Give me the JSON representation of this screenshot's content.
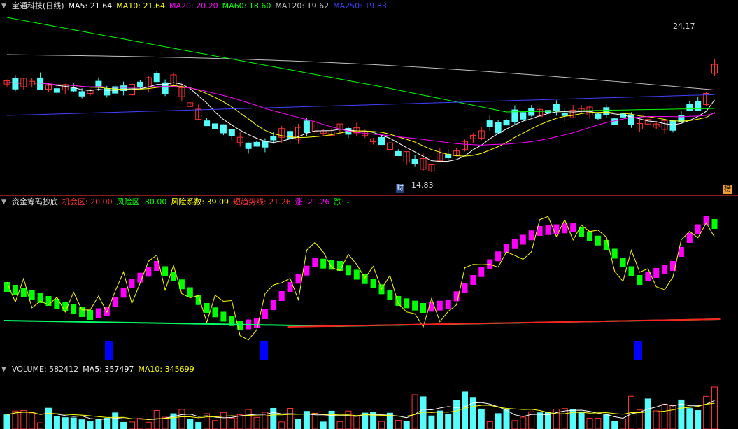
{
  "main": {
    "stock_name": "宝通科技(日线)",
    "ma5": "MA5: 21.64",
    "ma10": "MA10: 21.64",
    "ma20": "MA20: 20.20",
    "ma60": "MA60: 18.60",
    "ma120": "MA120: 19.62",
    "ma250": "MA250: 19.83",
    "high_label": "24.17",
    "low_label": "14.83",
    "cai_badge": "财",
    "bang_badge": "榜"
  },
  "indicator": {
    "name": "资金筹码抄底",
    "chance": "机会区: 20.00",
    "risk": "风险区: 80.00",
    "coef": "风险系数: 39.09",
    "trend": "短趋势线: 21.26",
    "up": "涨: 21.26",
    "down": "跌: -"
  },
  "volume": {
    "label": "VOLUME: 582412",
    "ma5": "MA5: 357497",
    "ma10": "MA10: 345699"
  },
  "colors": {
    "up": "#ff3232",
    "down": "#54fcfc",
    "ma5": "#ffffff",
    "ma10": "#ffff00",
    "ma20": "#ff00ff",
    "ma60": "#00ff00",
    "ma120": "#c0c0c0",
    "ma250": "#4040ff"
  }
}
